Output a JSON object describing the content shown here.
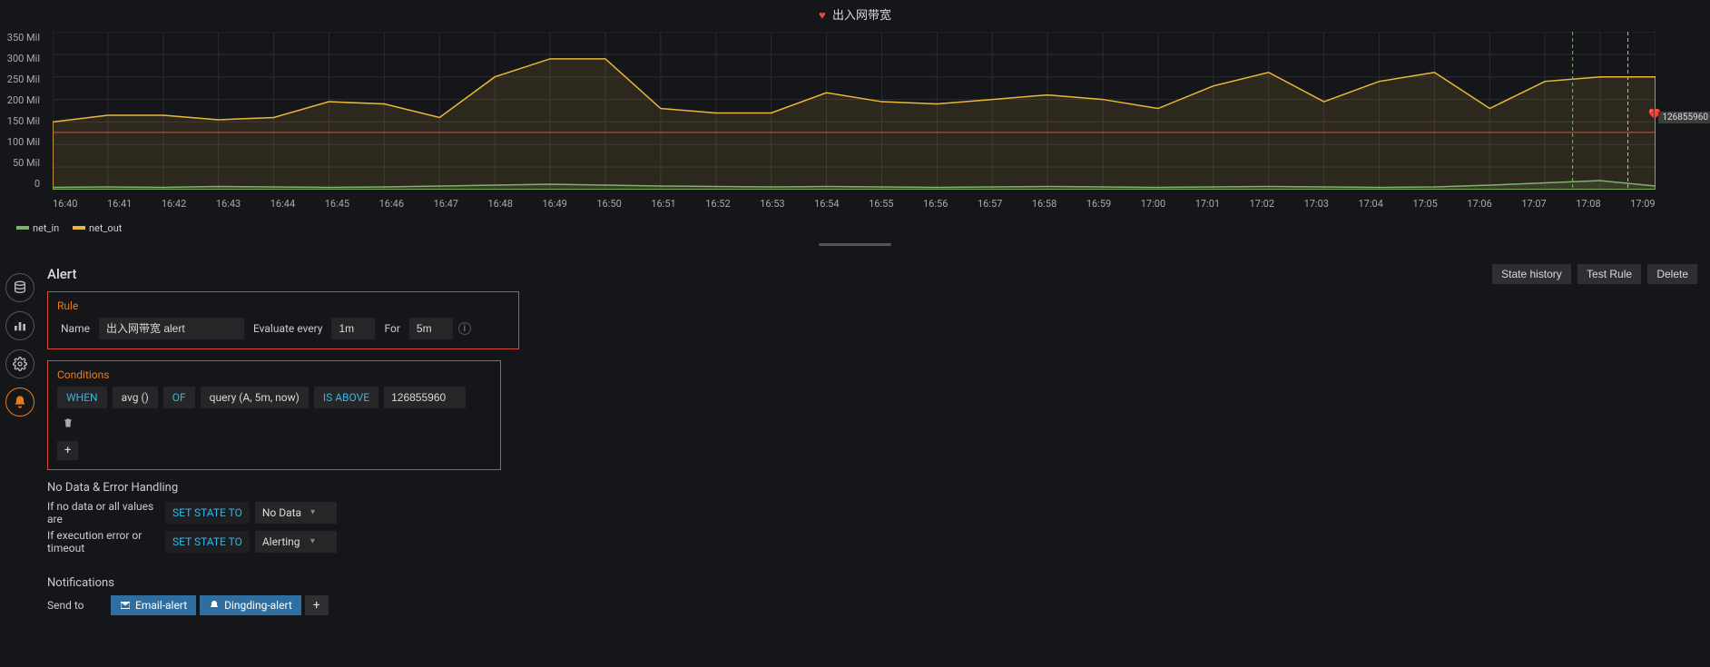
{
  "panel": {
    "title": "出入网带宽"
  },
  "chart_data": {
    "type": "line",
    "title": "出入网带宽",
    "xlabel": "",
    "ylabel": "",
    "ylim": [
      0,
      350000000
    ],
    "y_ticks": [
      "350 Mil",
      "300 Mil",
      "250 Mil",
      "200 Mil",
      "150 Mil",
      "100 Mil",
      "50 Mil",
      "0"
    ],
    "x_ticks": [
      "16:40",
      "16:41",
      "16:42",
      "16:43",
      "16:44",
      "16:45",
      "16:46",
      "16:47",
      "16:48",
      "16:49",
      "16:50",
      "16:51",
      "16:52",
      "16:53",
      "16:54",
      "16:55",
      "16:56",
      "16:57",
      "16:58",
      "16:59",
      "17:00",
      "17:01",
      "17:02",
      "17:03",
      "17:04",
      "17:05",
      "17:06",
      "17:07",
      "17:08",
      "17:09"
    ],
    "threshold": 126855960,
    "series": [
      {
        "name": "net_in",
        "color": "#7eb26d",
        "values": [
          5,
          6,
          5,
          7,
          6,
          5,
          6,
          8,
          10,
          12,
          10,
          8,
          7,
          6,
          7,
          6,
          5,
          6,
          7,
          6,
          5,
          6,
          7,
          6,
          5,
          6,
          10,
          15,
          20,
          8
        ]
      },
      {
        "name": "net_out",
        "color": "#eab839",
        "values": [
          150,
          165,
          165,
          155,
          160,
          195,
          190,
          160,
          250,
          290,
          290,
          180,
          170,
          170,
          215,
          195,
          190,
          200,
          210,
          200,
          180,
          230,
          260,
          195,
          240,
          260,
          180,
          240,
          250,
          250
        ]
      }
    ],
    "legend": [
      "net_in",
      "net_out"
    ],
    "vlines": [
      {
        "x_index": 27.5,
        "color": "green"
      },
      {
        "x_index": 28.5,
        "color": "yellow"
      }
    ]
  },
  "editor": {
    "header": "Alert",
    "buttons": {
      "state_history": "State history",
      "test_rule": "Test Rule",
      "delete": "Delete"
    }
  },
  "rule": {
    "box_title": "Rule",
    "name_label": "Name",
    "name_value": "出入网带宽 alert",
    "evaluate_label": "Evaluate every",
    "evaluate_value": "1m",
    "for_label": "For",
    "for_value": "5m"
  },
  "conditions": {
    "box_title": "Conditions",
    "when": "WHEN",
    "reducer": "avg ()",
    "of": "OF",
    "query": "query (A, 5m, now)",
    "evaluator": "IS ABOVE",
    "threshold": "126855960"
  },
  "nodata": {
    "title": "No Data & Error Handling",
    "row1_label": "If no data or all values are",
    "set_state": "SET STATE TO",
    "row1_value": "No Data",
    "row2_label": "If execution error or timeout",
    "row2_value": "Alerting"
  },
  "notifications": {
    "title": "Notifications",
    "send_to": "Send to",
    "channels": [
      "Email-alert",
      "Dingding-alert"
    ]
  },
  "side_tabs": [
    "queries",
    "visualization",
    "general",
    "alert"
  ],
  "threshold_label": "126855960"
}
